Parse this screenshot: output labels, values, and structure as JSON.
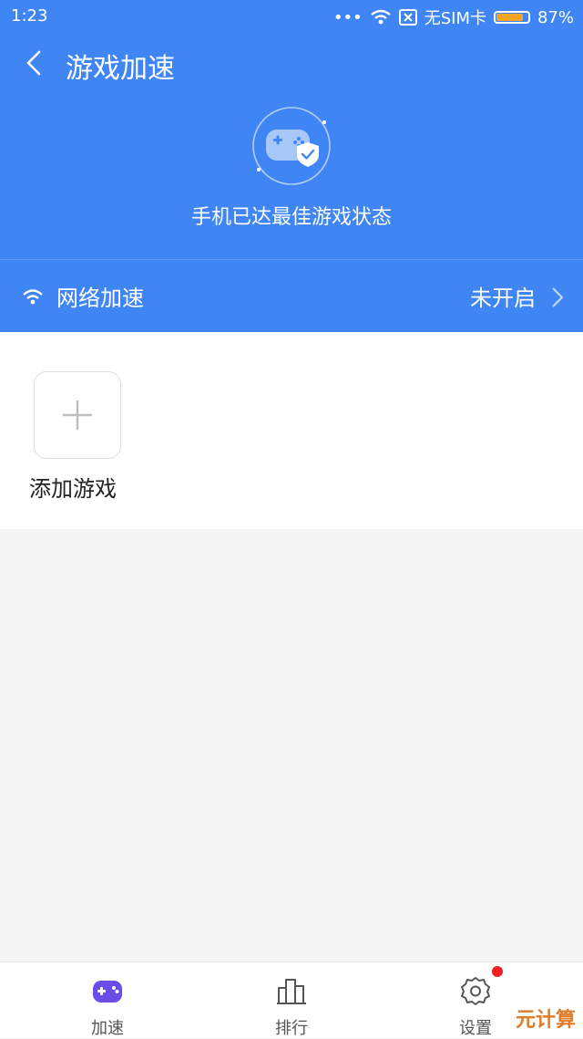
{
  "status_bar": {
    "time": "1:23",
    "dots": "•••",
    "sim": "无SIM卡",
    "battery_pct": "87%",
    "battery_level": 0.87
  },
  "header": {
    "title": "游戏加速",
    "subtitle": "手机已达最佳游戏状态"
  },
  "network": {
    "label": "网络加速",
    "status": "未开启"
  },
  "games": {
    "add_label": "添加游戏"
  },
  "tabs": [
    {
      "label": "加速",
      "icon": "gamepad-icon",
      "active": true
    },
    {
      "label": "排行",
      "icon": "ranking-icon",
      "active": false
    },
    {
      "label": "设置",
      "icon": "settings-icon",
      "active": false,
      "badge": true
    }
  ],
  "watermark": "元计算",
  "colors": {
    "header_bg": "#3f86f4",
    "active_tab": "#6a4de8",
    "badge": "#f02020",
    "battery": "#f4a623"
  }
}
